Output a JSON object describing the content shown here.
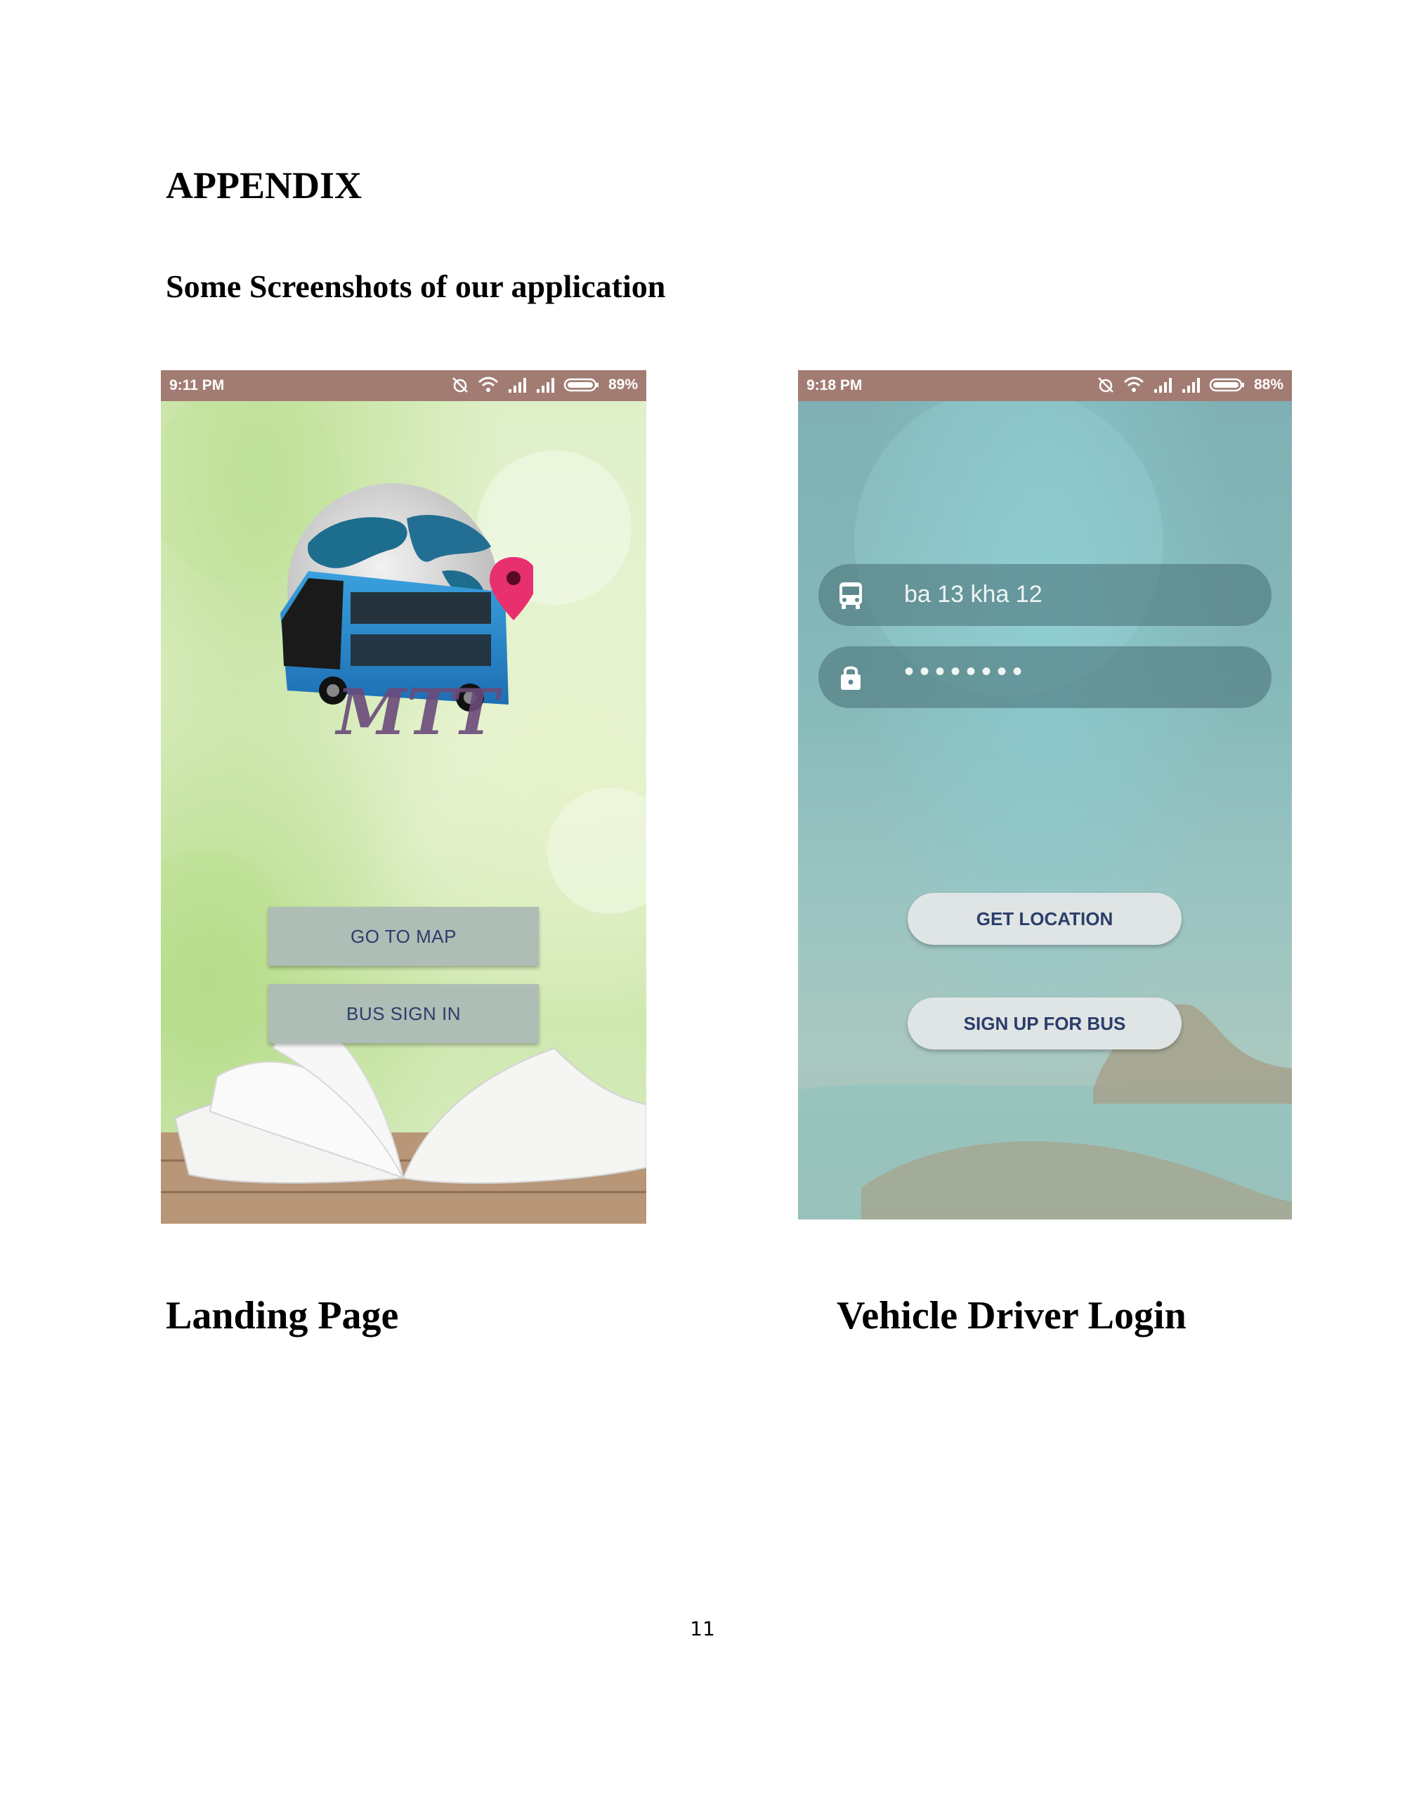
{
  "document": {
    "heading": "APPENDIX",
    "subheading": "Some Screenshots of our application",
    "page_number": "11"
  },
  "landing_screen": {
    "caption": "Landing Page",
    "status_bar": {
      "time": "9:11 PM",
      "battery": "89%"
    },
    "logo_text": "MTT",
    "buttons": {
      "go_to_map": "GO TO MAP",
      "bus_sign_in": "BUS SIGN IN"
    }
  },
  "driver_screen": {
    "caption": "Vehicle Driver Login",
    "status_bar": {
      "time": "9:18 PM",
      "battery": "88%"
    },
    "vehicle_field_value": "ba 13 kha 12",
    "password_field_value": "••••••••",
    "buttons": {
      "get_location": "GET LOCATION",
      "sign_up_for_bus": "SIGN UP FOR BUS"
    }
  },
  "colors": {
    "status_bar": "#a27c73",
    "button_text": "#2b3d6b",
    "landing_button_bg": "#aebdb5",
    "pill_button_bg": "#dfe4e4"
  },
  "icons": [
    "no-alarm-icon",
    "wifi-icon",
    "signal-icon",
    "battery-icon",
    "bus-icon",
    "lock-icon",
    "location-pin-icon"
  ]
}
